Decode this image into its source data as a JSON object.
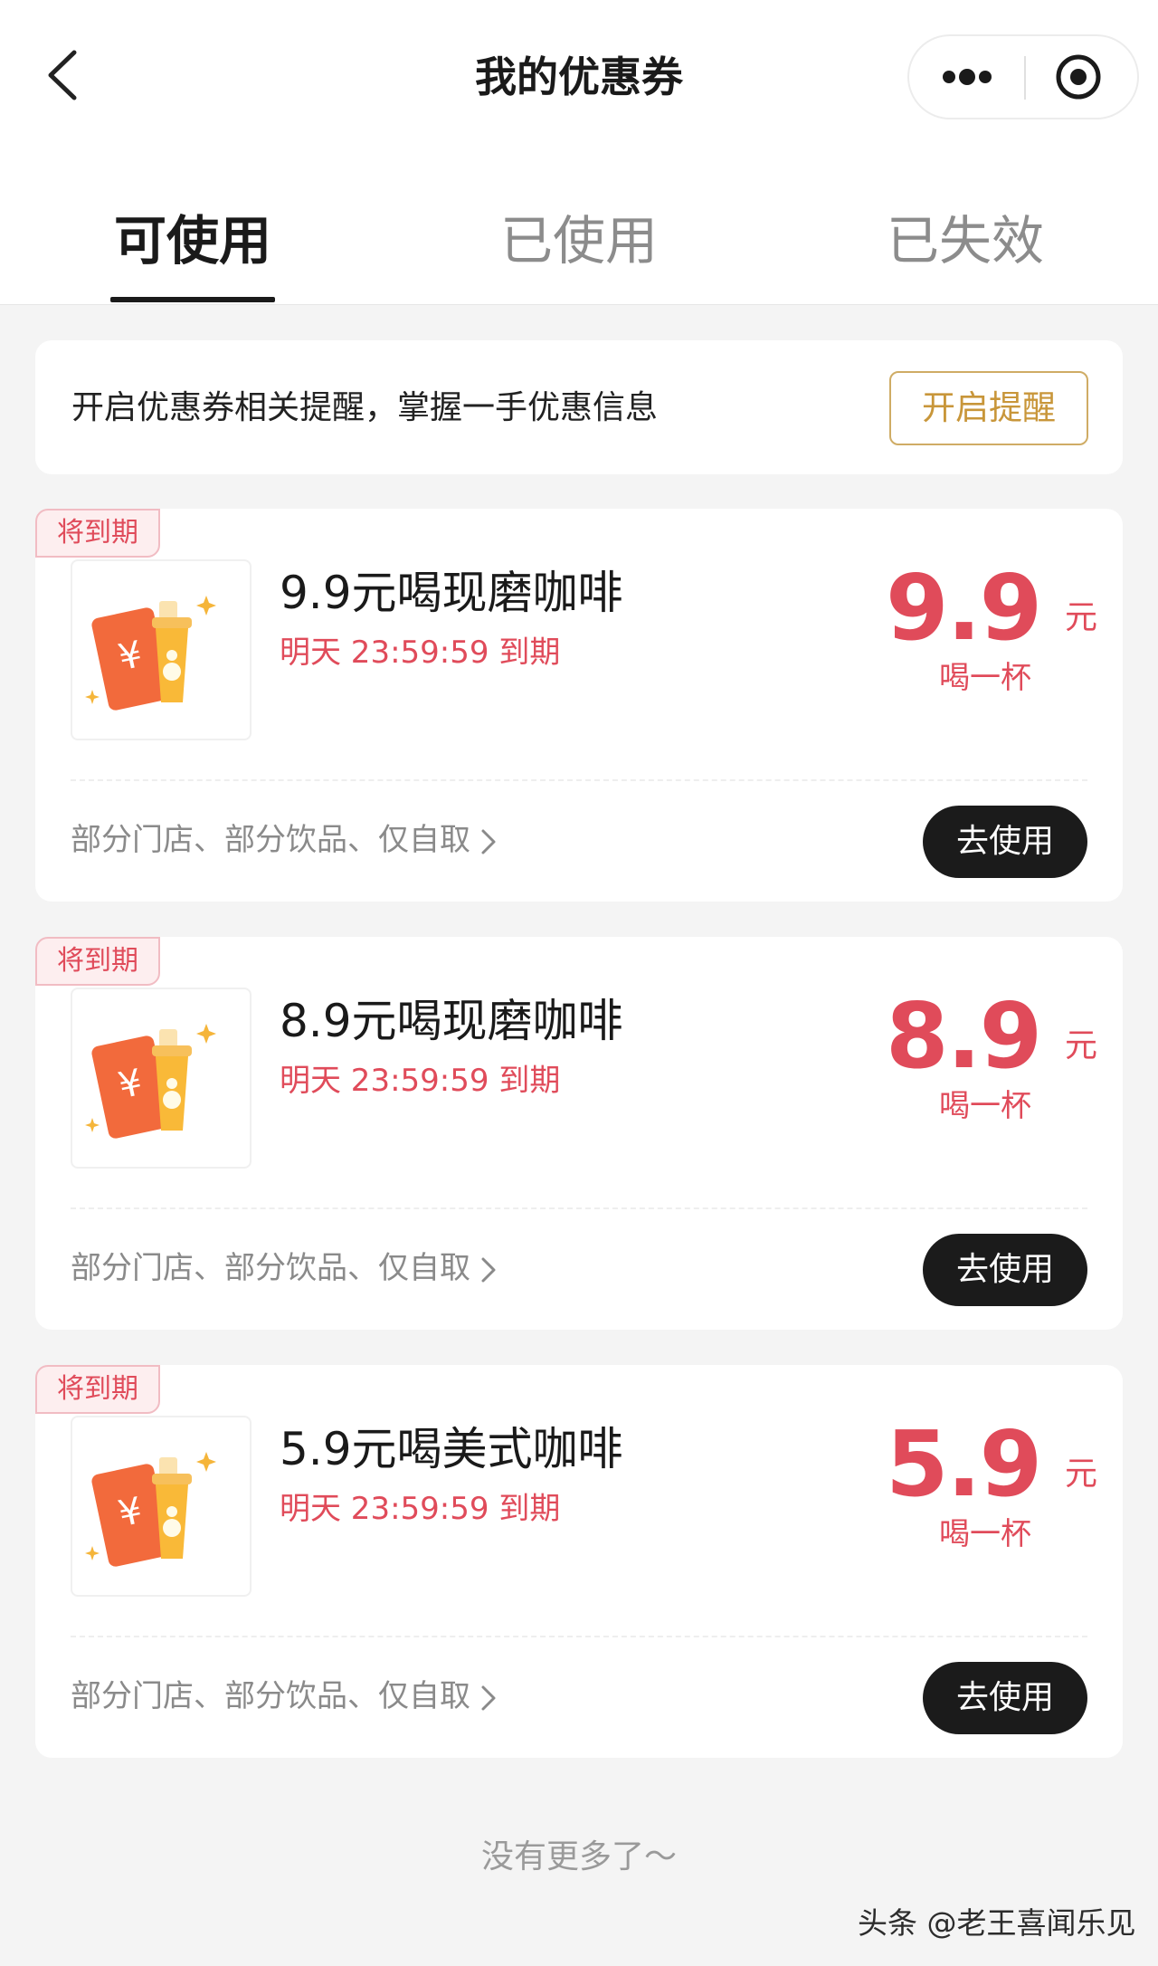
{
  "header": {
    "title": "我的优惠券"
  },
  "tabs": [
    {
      "label": "可使用",
      "active": true
    },
    {
      "label": "已使用",
      "active": false
    },
    {
      "label": "已失效",
      "active": false
    }
  ],
  "reminder": {
    "text": "开启优惠券相关提醒，掌握一手优惠信息",
    "button": "开启提醒"
  },
  "coupons": [
    {
      "badge": "将到期",
      "title": "9.9元喝现磨咖啡",
      "expiry": "明天 23:59:59 到期",
      "price": "9.9",
      "unit": "元",
      "price_sub": "喝一杯",
      "rules": "部分门店、部分饮品、仅自取",
      "action": "去使用"
    },
    {
      "badge": "将到期",
      "title": "8.9元喝现磨咖啡",
      "expiry": "明天 23:59:59 到期",
      "price": "8.9",
      "unit": "元",
      "price_sub": "喝一杯",
      "rules": "部分门店、部分饮品、仅自取",
      "action": "去使用"
    },
    {
      "badge": "将到期",
      "title": "5.9元喝美式咖啡",
      "expiry": "明天 23:59:59 到期",
      "price": "5.9",
      "unit": "元",
      "price_sub": "喝一杯",
      "rules": "部分门店、部分饮品、仅自取",
      "action": "去使用"
    }
  ],
  "footer": {
    "no_more": "没有更多了～"
  },
  "watermark": "头条 @老王喜闻乐见",
  "colors": {
    "accent_red": "#e04b5a",
    "gold": "#c8963a",
    "button_dark": "#1b1b1b",
    "background": "#f4f4f4"
  },
  "icons": [
    "chevron-left-icon",
    "more-dots-icon",
    "record-target-icon",
    "coupon-drink-icon",
    "chevron-right-icon"
  ]
}
